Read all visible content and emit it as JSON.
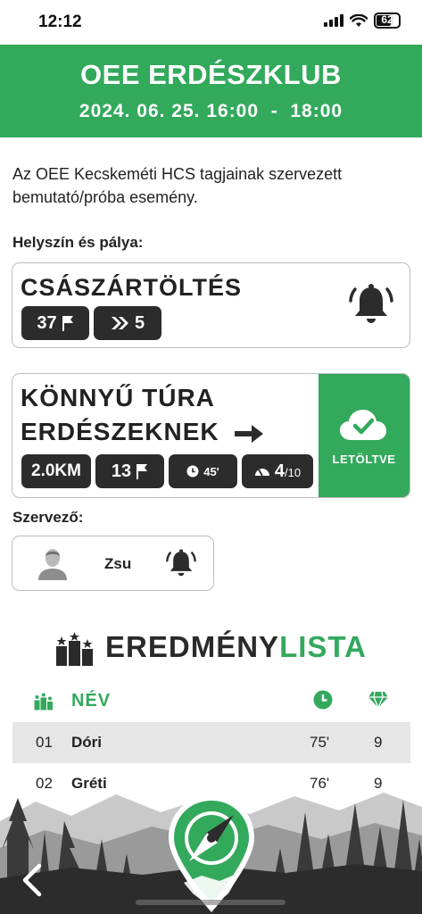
{
  "status_bar": {
    "time": "12:12",
    "battery": "62"
  },
  "header": {
    "title": "OEE ERDÉSZKLUB",
    "date": "2024. 06. 25. 16:00  -  18:00"
  },
  "description": "Az OEE Kecskeméti HCS tagjainak szervezett bemutató/próba esemény.",
  "venue": {
    "label": "Helyszín és pálya:",
    "name": "CSÁSZÁRTÖLTÉS",
    "controls": "37",
    "courses": "5"
  },
  "route": {
    "name_line1": "KÖNNYŰ TÚRA",
    "name_line2": "ERDÉSZEKNEK",
    "distance": "2.0KM",
    "controls": "13",
    "time": "45'",
    "difficulty": "4",
    "difficulty_max": "/10",
    "download_status": "LETÖLTVE"
  },
  "organizer": {
    "label": "Szervező:",
    "name": "Zsu"
  },
  "results": {
    "title_dark": "EREDMÉNY",
    "title_green": "LISTA",
    "header_name": "NÉV",
    "rows": [
      {
        "place": "01",
        "name": "Dóri",
        "time": "75'",
        "score": "9"
      },
      {
        "place": "02",
        "name": "Gréti",
        "time": "76'",
        "score": "9"
      }
    ]
  },
  "colors": {
    "brand_green": "#33a95c",
    "dark": "#2c2c2c"
  },
  "icons": [
    "flag-icon",
    "double-chevron-icon",
    "bell-icon",
    "arrow-right-icon",
    "clock-icon",
    "gauge-icon",
    "cloud-check-icon",
    "user-avatar-icon",
    "podium-icon",
    "diamond-icon",
    "compass-pin-icon",
    "back-chevron-icon"
  ]
}
